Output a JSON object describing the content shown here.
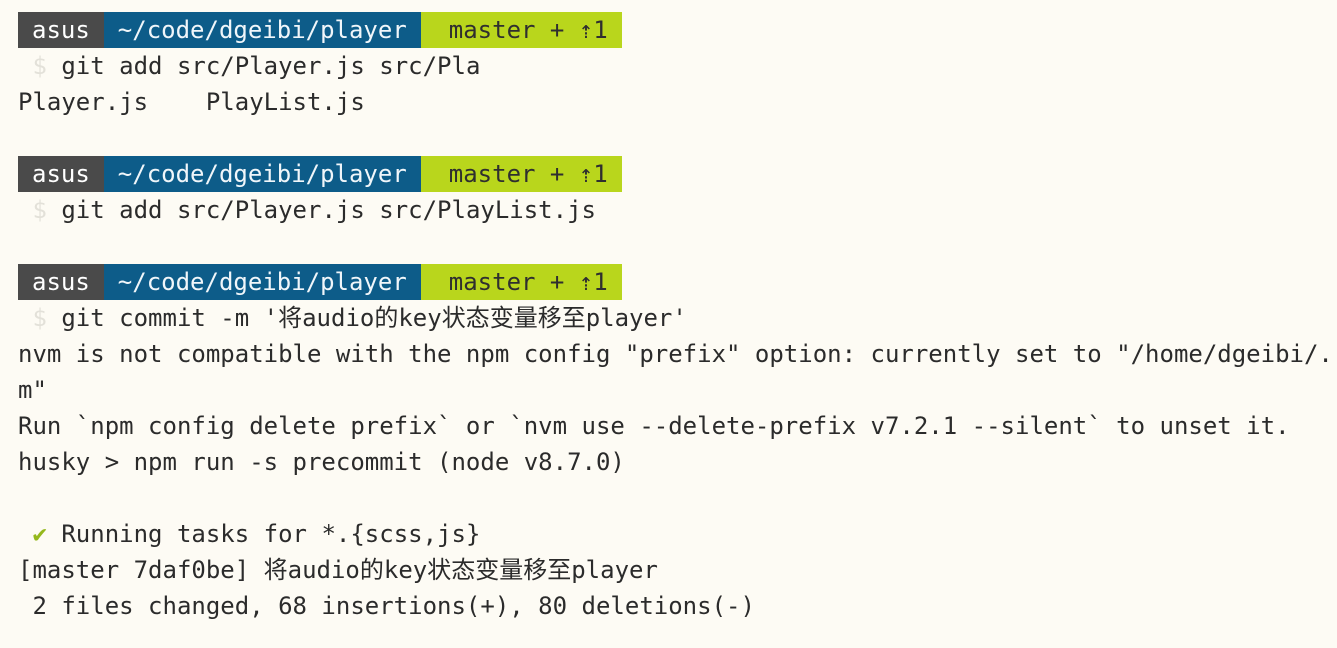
{
  "colors": {
    "background": "#fdfbf4",
    "user_segment": "#4a4a4a",
    "path_segment": "#0d5c89",
    "branch_segment": "#b9d61c",
    "check_mark": "#95b81c",
    "dollar": "#e3e1d9"
  },
  "prompt": {
    "user": "asus",
    "path": "~/code/dgeibi/player",
    "branch": "master + ⇡1",
    "symbol": "$"
  },
  "lines": {
    "cmd1": "git add src/Player.js src/Pla",
    "completions": "Player.js    PlayList.js",
    "cmd2": "git add src/Player.js src/PlayList.js",
    "cmd3": "git commit -m '将audio的key状态变量移至player'",
    "out1": "nvm is not compatible with the npm config \"prefix\" option: currently set to \"/home/dgeibi/.np",
    "out2": "m\"",
    "out3": "Run `npm config delete prefix` or `nvm use --delete-prefix v7.2.1 --silent` to unset it.",
    "out4": "husky > npm run -s precommit (node v8.7.0)",
    "check_icon": "✔",
    "out5": "Running tasks for *.{scss,js}",
    "out6": "[master 7daf0be] 将audio的key状态变量移至player",
    "out7": " 2 files changed, 68 insertions(+), 80 deletions(-)"
  }
}
